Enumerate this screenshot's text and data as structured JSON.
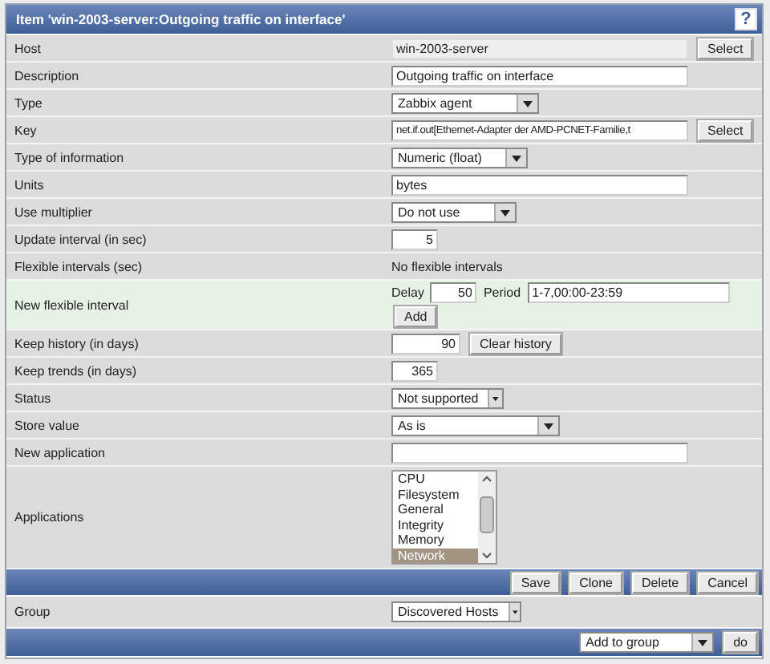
{
  "window": {
    "title": "Item 'win-2003-server:Outgoing traffic on interface'",
    "help": "?"
  },
  "rows": [
    {
      "label": "Host",
      "kind": "readonly",
      "value": "win-2003-server",
      "button": "Select"
    },
    {
      "label": "Description",
      "kind": "text",
      "value": "Outgoing traffic on interface"
    },
    {
      "label": "Type",
      "kind": "select",
      "value": "Zabbix agent"
    },
    {
      "label": "Key",
      "kind": "text",
      "value": "net.if.out[Ethernet-Adapter der AMD-PCNET-Familie,t",
      "button": "Select"
    },
    {
      "label": "Type of information",
      "kind": "select",
      "value": "Numeric (float)"
    },
    {
      "label": "Units",
      "kind": "text",
      "value": "bytes"
    },
    {
      "label": "Use multiplier",
      "kind": "select",
      "value": "Do not use"
    },
    {
      "label": "Update interval (in sec)",
      "kind": "number",
      "value": "5"
    },
    {
      "label": "Flexible intervals (sec)",
      "kind": "plain",
      "value": "No flexible intervals"
    },
    {
      "label": "New flexible interval",
      "kind": "flex",
      "delay_label": "Delay",
      "delay": "50",
      "period_label": "Period",
      "period": "1-7,00:00-23:59",
      "button": "Add"
    },
    {
      "label": "Keep history (in days)",
      "kind": "number",
      "value": "90",
      "button": "Clear history"
    },
    {
      "label": "Keep trends (in days)",
      "kind": "number",
      "value": "365"
    },
    {
      "label": "Status",
      "kind": "select",
      "value": "Not supported"
    },
    {
      "label": "Store value",
      "kind": "select",
      "value": "As is"
    },
    {
      "label": "New application",
      "kind": "text"
    },
    {
      "label": "Applications",
      "kind": "list",
      "options": [
        {
          "label": "CPU",
          "selected": false
        },
        {
          "label": "Filesystem",
          "selected": false
        },
        {
          "label": "General",
          "selected": false
        },
        {
          "label": "Integrity",
          "selected": false
        },
        {
          "label": "Memory",
          "selected": false
        },
        {
          "label": "Network",
          "selected": true
        }
      ]
    }
  ],
  "actions": [
    "Save",
    "Clone",
    "Delete",
    "Cancel"
  ],
  "group": {
    "label": "Group",
    "value": "Discovered Hosts"
  },
  "footer": {
    "select": "Add to group",
    "button": "do"
  }
}
